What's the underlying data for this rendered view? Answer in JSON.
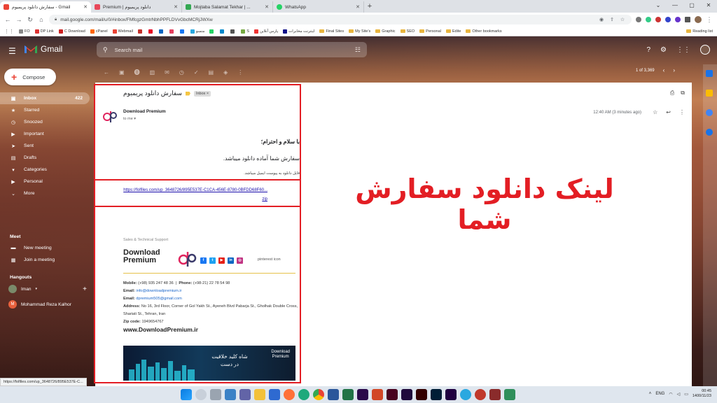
{
  "browser": {
    "tabs": [
      {
        "title": "سفارش دانلود پریمیوم - Gmail",
        "color": "#ea4335",
        "active": true
      },
      {
        "title": "Premium | دانلود پریمیوم",
        "color": "#e8475a",
        "active": false
      },
      {
        "title": "Mojtaba Salamat Tekhar | ...",
        "color": "#34a853",
        "active": false
      },
      {
        "title": "WhatsApp",
        "color": "#25d366",
        "active": false
      }
    ],
    "url": "mail.google.com/mail/u/0/#inbox/FMfcgzGmtrNbhPPFLDVvGbcMCRjJWXw",
    "bookmarks": [
      {
        "label": "FO",
        "color": "#888"
      },
      {
        "label": "DP Link",
        "color": "#d33"
      },
      {
        "label": "C Download",
        "color": "#c22"
      },
      {
        "label": "cPanel",
        "color": "#f60"
      },
      {
        "label": "Webmail",
        "color": "#ea4335"
      },
      {
        "label": "",
        "color": "#c4302b"
      },
      {
        "label": "",
        "color": "#e60023"
      },
      {
        "label": "",
        "color": "#0a66c2"
      },
      {
        "label": "",
        "color": "#e4405f"
      },
      {
        "label": "",
        "color": "#1877f2"
      },
      {
        "label": "منسو",
        "color": "#2aa8e0"
      },
      {
        "label": "",
        "color": "#25d366"
      },
      {
        "label": "",
        "color": "#0088cc"
      },
      {
        "label": "",
        "color": "#555"
      },
      {
        "label": "S",
        "color": "#7a4"
      },
      {
        "label": "پارس آنلاین",
        "color": "#e33"
      },
      {
        "label": "اینترنت مخابرات",
        "color": "#118"
      }
    ],
    "folders": [
      "Final Sites",
      "My Site's",
      "Graphic",
      "SEO",
      "Personal",
      "Edite"
    ],
    "other_bookmarks": "Other bookmarks",
    "reading_list": "Reading list"
  },
  "gmail": {
    "logo": "Gmail",
    "search_placeholder": "Search mail",
    "compose": "Compose",
    "nav": [
      {
        "label": "Inbox",
        "icon": "inbox-icon",
        "glyph": "▣",
        "count": "422",
        "active": true
      },
      {
        "label": "Starred",
        "icon": "star-icon",
        "glyph": "★",
        "count": "",
        "active": false
      },
      {
        "label": "Snoozed",
        "icon": "clock-icon",
        "glyph": "◷",
        "count": "",
        "active": false
      },
      {
        "label": "Important",
        "icon": "label-icon",
        "glyph": "▶",
        "count": "",
        "active": false
      },
      {
        "label": "Sent",
        "icon": "send-icon",
        "glyph": "➤",
        "count": "",
        "active": false
      },
      {
        "label": "Drafts",
        "icon": "draft-icon",
        "glyph": "▤",
        "count": "",
        "active": false
      },
      {
        "label": "Categories",
        "icon": "categories-icon",
        "glyph": "▾",
        "count": "",
        "active": false
      },
      {
        "label": "Personal",
        "icon": "personal-label-icon",
        "glyph": "▶",
        "count": "",
        "active": false
      },
      {
        "label": "More",
        "icon": "more-icon",
        "glyph": "⌄",
        "count": "",
        "active": false
      }
    ],
    "meet": {
      "title": "Meet",
      "items": [
        "New meeting",
        "Join a meeting"
      ]
    },
    "hangouts": {
      "title": "Hangouts",
      "user": "Iman",
      "contact": "Mohammad Reza Kalhor",
      "contact_initial": "M"
    },
    "pager": "1 of 3,369"
  },
  "email": {
    "subject": "سفارش دانلود پریمیوم",
    "label": "Inbox ×",
    "sender": "Download Premium",
    "to": "to me ▾",
    "time": "12:40 AM (3 minutes ago)",
    "greeting": "با سلام و احترام؛",
    "ready": "سفارش شما آماده دانلود میباشد.",
    "note": "فایل دانلود به پیوست ایمیل میباشد.",
    "link": "https://folfiles.com/up_3648726/895E537E-C1CA-456E-8780-0BFDD68F60...zip",
    "signature": {
      "header": "Sales & Technical Support",
      "brand_line1": "Download",
      "brand_line2": "Premium",
      "pinterest_alt": "pinterest icon",
      "mobile_label": "Mobile:",
      "mobile": "(+98) 935 247 48 36",
      "phone_label": "Phone:",
      "phone": "(+98-21) 22 78 54 98",
      "email1_label": "Email:",
      "email1": "info@downloadpremium.ir",
      "email2_label": "Email:",
      "email2": "dpremium505@gmail.com",
      "address_label": "Address:",
      "address": "No 16, 3rd Floor, Corner of Gol Yakh St., Ayeneh Blvd Pabarja St., Gholhak Double Cross, Shariati St., Tehran, Iran",
      "zip_label": "Zip code:",
      "zip": "1949654767",
      "website": "www.DownloadPremium.ir",
      "banner_text": "شاه کلید خلاقیت در دست",
      "banner_brand1": "Download",
      "banner_brand2": "Premium"
    }
  },
  "overlay_text": "لینک دانلود سفارش شما",
  "status_url": "https://folfiles.com/up_3648726/895E537E-C...",
  "taskbar": {
    "lang": "ENG",
    "time": "00:45",
    "date": "1400/11/23"
  },
  "colors": {
    "accent_red": "#e31e24",
    "gmail_red": "#ea4335",
    "link_blue": "#1a0dab"
  }
}
